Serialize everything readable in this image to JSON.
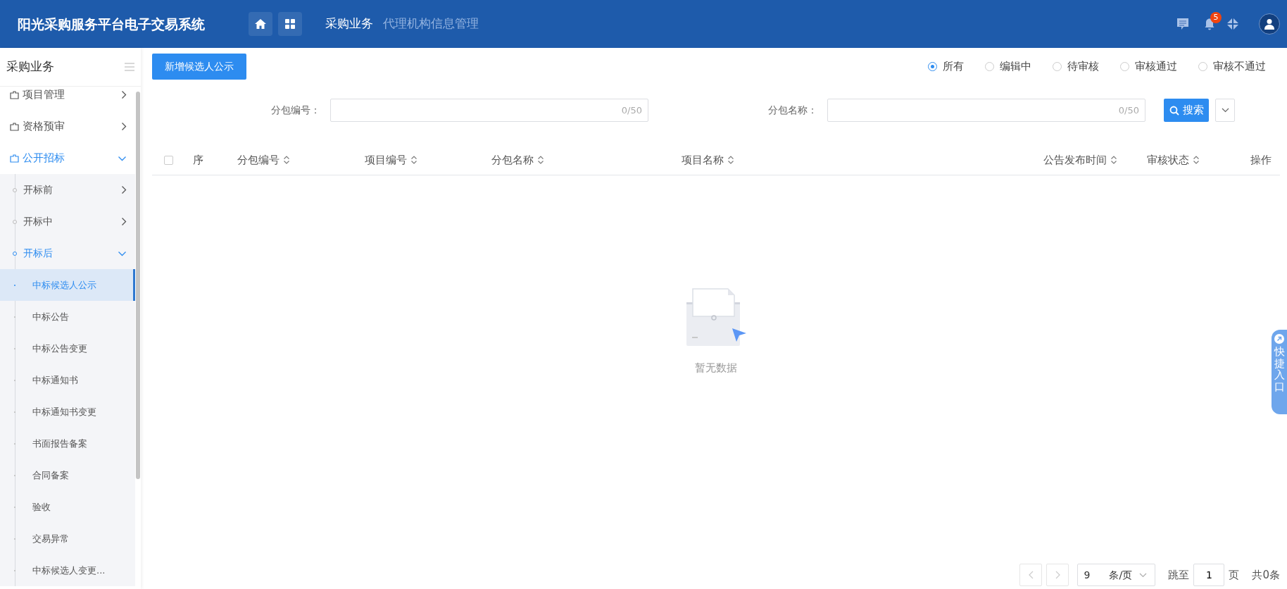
{
  "header": {
    "title": "阳光采购服务平台电子交易系统",
    "nav_tabs": [
      {
        "label": "采购业务",
        "selected": true
      },
      {
        "label": "代理机构信息管理",
        "selected": false
      }
    ],
    "notification_count": "5"
  },
  "sidebar": {
    "title": "采购业务",
    "items": [
      {
        "kind": "group",
        "label": "项目管理",
        "expanded": false
      },
      {
        "kind": "group",
        "label": "资格预审",
        "expanded": false
      },
      {
        "kind": "group",
        "label": "公开招标",
        "expanded": true,
        "children": [
          {
            "kind": "group",
            "label": "开标前",
            "expanded": false
          },
          {
            "kind": "group",
            "label": "开标中",
            "expanded": false
          },
          {
            "kind": "group",
            "label": "开标后",
            "expanded": true,
            "children": [
              {
                "kind": "leaf",
                "label": "中标候选人公示",
                "selected": true
              },
              {
                "kind": "leaf",
                "label": "中标公告",
                "selected": false
              },
              {
                "kind": "leaf",
                "label": "中标公告变更",
                "selected": false
              },
              {
                "kind": "leaf",
                "label": "中标通知书",
                "selected": false
              },
              {
                "kind": "leaf",
                "label": "中标通知书变更",
                "selected": false
              },
              {
                "kind": "leaf",
                "label": "书面报告备案",
                "selected": false
              },
              {
                "kind": "leaf",
                "label": "合同备案",
                "selected": false
              },
              {
                "kind": "leaf",
                "label": "验收",
                "selected": false
              },
              {
                "kind": "leaf",
                "label": "交易异常",
                "selected": false
              },
              {
                "kind": "leaf",
                "label": "中标候选人变更...",
                "selected": false
              }
            ]
          }
        ]
      }
    ]
  },
  "toolbar": {
    "add_button": "新增候选人公示",
    "status_filter": [
      {
        "label": "所有",
        "selected": true
      },
      {
        "label": "编辑中",
        "selected": false
      },
      {
        "label": "待审核",
        "selected": false
      },
      {
        "label": "审核通过",
        "selected": false
      },
      {
        "label": "审核不通过",
        "selected": false
      }
    ]
  },
  "search": {
    "fields": [
      {
        "label": "分包编号：",
        "counter": "0/50"
      },
      {
        "label": "分包名称：",
        "counter": "0/50"
      }
    ],
    "button": "搜索"
  },
  "table": {
    "columns": [
      {
        "label": "序",
        "sortable": false
      },
      {
        "label": "分包编号",
        "sortable": true
      },
      {
        "label": "项目编号",
        "sortable": true
      },
      {
        "label": "分包名称",
        "sortable": true
      },
      {
        "label": "项目名称",
        "sortable": true
      },
      {
        "label": "公告发布时间",
        "sortable": true
      },
      {
        "label": "审核状态",
        "sortable": true
      },
      {
        "label": "操作",
        "sortable": false
      }
    ],
    "select_all_checked": false,
    "empty_text": "暂无数据"
  },
  "pagination": {
    "page_size": "9",
    "page_size_unit": "条/页",
    "jump_label": "跳至",
    "page": "1",
    "page_unit": "页",
    "total": "共0条"
  },
  "quick_entry": {
    "label": "快捷入口"
  }
}
